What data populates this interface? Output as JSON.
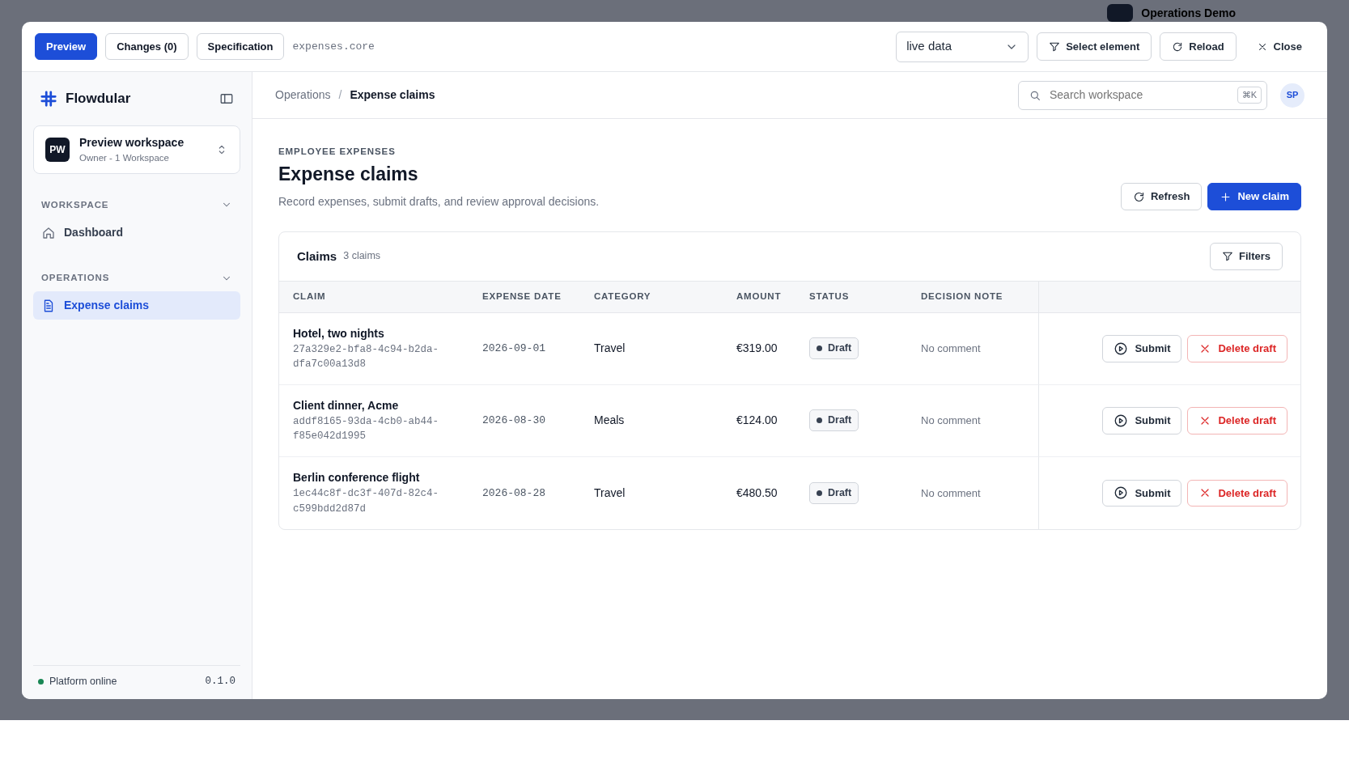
{
  "background": {
    "title": "Operations Demo"
  },
  "toolbar": {
    "tabs": [
      {
        "label": "Preview",
        "selected": true
      },
      {
        "label": "Changes (0)",
        "selected": false
      },
      {
        "label": "Specification",
        "selected": false
      }
    ],
    "module": "expenses.core",
    "source": "live data",
    "buttons": [
      {
        "label": "Select element",
        "kind": "filter"
      },
      {
        "label": "Reload",
        "kind": "reload"
      },
      {
        "label": "Close",
        "kind": "close"
      }
    ]
  },
  "sidebar": {
    "brand": "Flowdular",
    "workspace": {
      "initials": "PW",
      "name": "Preview workspace",
      "role": "Owner - 1 Workspace"
    },
    "sections": [
      {
        "title": "WORKSPACE",
        "expanded": true,
        "items": [
          {
            "label": "Dashboard",
            "kind": "home",
            "selected": false
          }
        ]
      },
      {
        "title": "OPERATIONS",
        "expanded": true,
        "items": [
          {
            "label": "Expense claims",
            "kind": "document",
            "selected": true
          }
        ]
      }
    ],
    "status": {
      "label": "Platform online",
      "color": "#198754",
      "version": "0.1.0"
    }
  },
  "topbar": {
    "breadcrumbs": [
      "Operations",
      "Expense claims"
    ],
    "separator": "/",
    "search": {
      "placeholder": "Search workspace",
      "shortcut": "⌘K"
    },
    "avatar": "SP"
  },
  "page": {
    "eyebrow": "EMPLOYEE EXPENSES",
    "title": "Expense claims",
    "description": "Record expenses, submit drafts, and review approval decisions.",
    "buttons": [
      {
        "label": "Refresh",
        "kind": "refresh"
      },
      {
        "label": "New claim",
        "kind": "add"
      }
    ]
  },
  "table": {
    "title": "Claims",
    "count": "3 claims",
    "filter": "Filters",
    "columns": [
      "CLAIM",
      "EXPENSE DATE",
      "CATEGORY",
      "AMOUNT",
      "STATUS",
      "DECISION NOTE"
    ],
    "rows": [
      {
        "name": "Hotel, two nights",
        "id": "27a329e2-bfa8-4c94-b2da-dfa7c00a13d8",
        "date": "2026-09-01",
        "category": "Travel",
        "amount": "€319.00",
        "status": "Draft",
        "note": "No comment",
        "actions": [
          "Submit",
          "Delete draft"
        ]
      },
      {
        "name": "Client dinner, Acme",
        "id": "addf8165-93da-4cb0-ab44-f85e042d1995",
        "date": "2026-08-30",
        "category": "Meals",
        "amount": "€124.00",
        "status": "Draft",
        "note": "No comment",
        "actions": [
          "Submit",
          "Delete draft"
        ]
      },
      {
        "name": "Berlin conference flight",
        "id": "1ec44c8f-dc3f-407d-82c4-c599bdd2d87d",
        "date": "2026-08-28",
        "category": "Travel",
        "amount": "€480.50",
        "status": "Draft",
        "note": "No comment",
        "actions": [
          "Submit",
          "Delete draft"
        ]
      }
    ]
  }
}
